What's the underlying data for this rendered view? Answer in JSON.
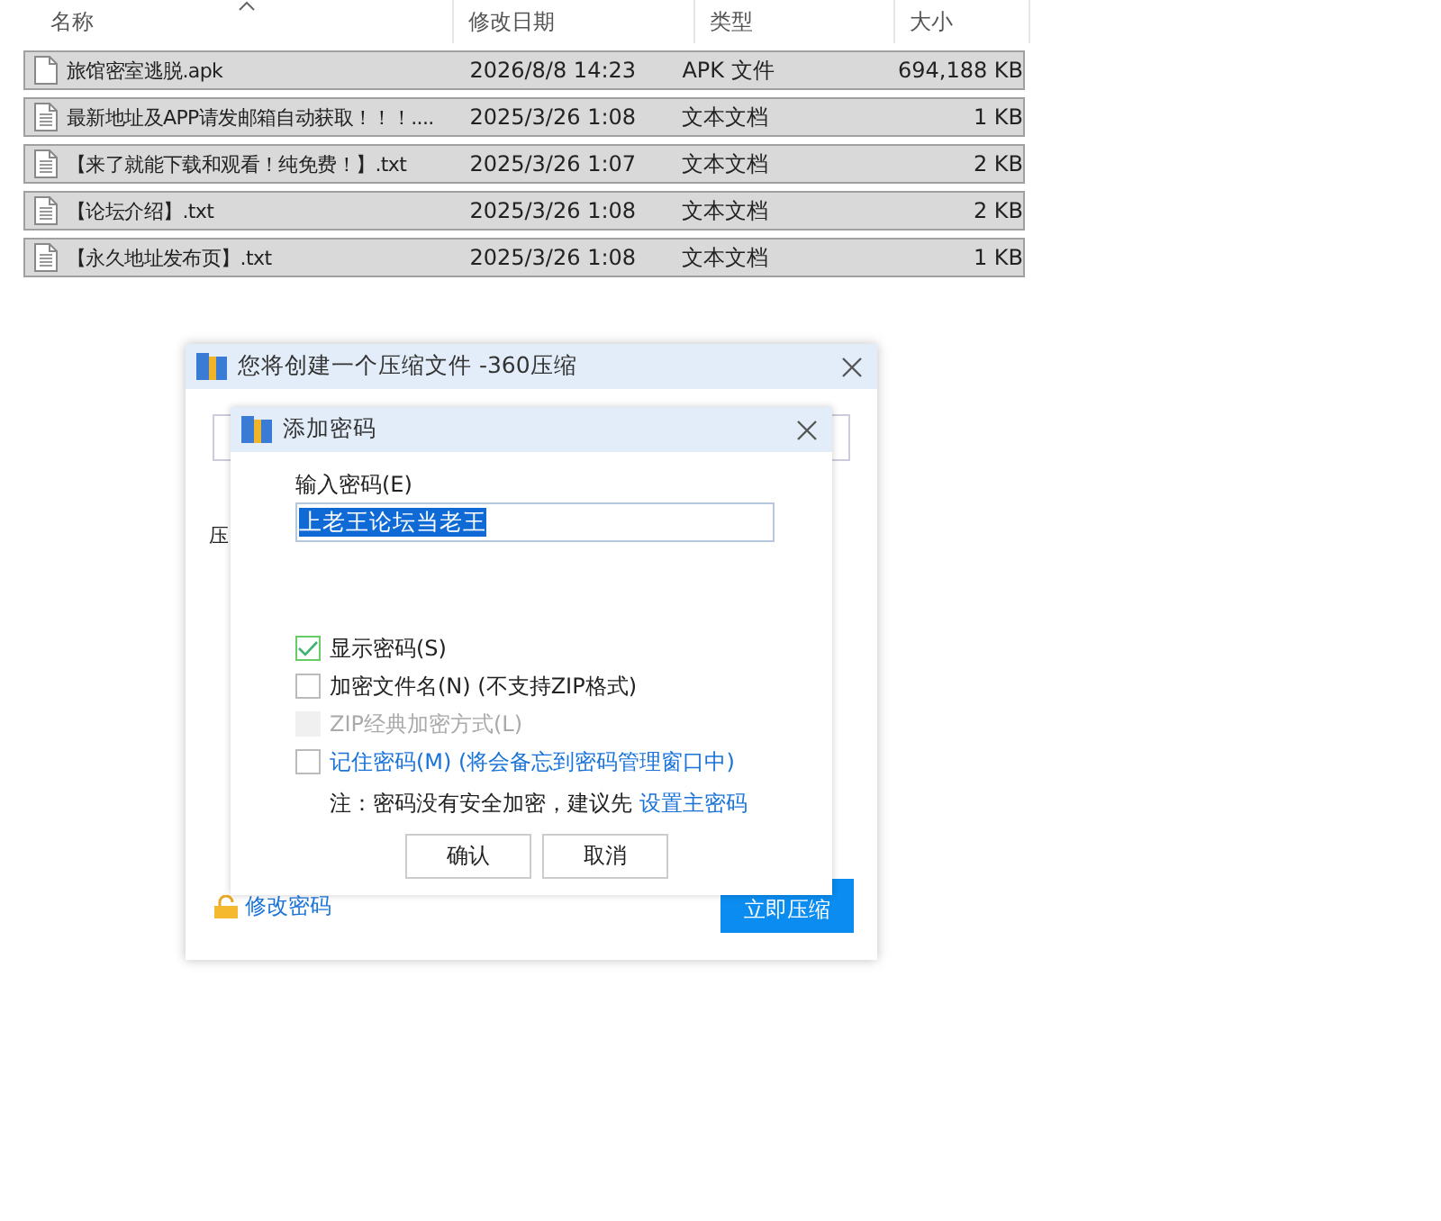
{
  "explorer": {
    "columns": [
      {
        "label": "名称",
        "sorted": true
      },
      {
        "label": "修改日期",
        "sorted": false
      },
      {
        "label": "类型",
        "sorted": false
      },
      {
        "label": "大小",
        "sorted": false
      }
    ],
    "rows": [
      {
        "kind": "apk",
        "name": "旅馆密室逃脱.apk",
        "date": "2026/8/8 14:23",
        "type": "APK 文件",
        "size": "694,188 KB",
        "selected": true
      },
      {
        "kind": "txt",
        "name": "最新地址及APP请发邮箱自动获取！！！....",
        "date": "2025/3/26 1:08",
        "type": "文本文档",
        "size": "1 KB",
        "selected": true
      },
      {
        "kind": "txt",
        "name": "【来了就能下载和观看！纯免费！】.txt",
        "date": "2025/3/26 1:07",
        "type": "文本文档",
        "size": "2 KB",
        "selected": true
      },
      {
        "kind": "txt",
        "name": "【论坛介绍】.txt",
        "date": "2025/3/26 1:08",
        "type": "文本文档",
        "size": "2 KB",
        "selected": true
      },
      {
        "kind": "txt",
        "name": "【永久地址发布页】.txt",
        "date": "2025/3/26 1:08",
        "type": "文本文档",
        "size": "1 KB",
        "selected": true
      }
    ]
  },
  "compress_dialog": {
    "title": "您将创建一个压缩文件 -360压缩",
    "label": "压",
    "change_password_link": "修改密码",
    "compress_button": "立即压缩"
  },
  "password_dialog": {
    "title": "添加密码",
    "password_label": "输入密码(E)",
    "password_value": "上老王论坛当老王",
    "options": [
      {
        "kind": "plain",
        "label": "显示密码(S)",
        "checked": true,
        "disabled": false
      },
      {
        "kind": "plain",
        "label": "加密文件名(N) (不支持ZIP格式)",
        "checked": false,
        "disabled": false
      },
      {
        "kind": "plain",
        "label": "ZIP经典加密方式(L)",
        "checked": false,
        "disabled": true
      },
      {
        "kind": "link",
        "label": "记住密码(M) (将会备忘到密码管理窗口中)",
        "checked": false,
        "disabled": false
      }
    ],
    "note": "注：密码没有安全加密，建议先",
    "note_link": "设置主密码",
    "buttons": [
      "确认",
      "取消"
    ]
  }
}
